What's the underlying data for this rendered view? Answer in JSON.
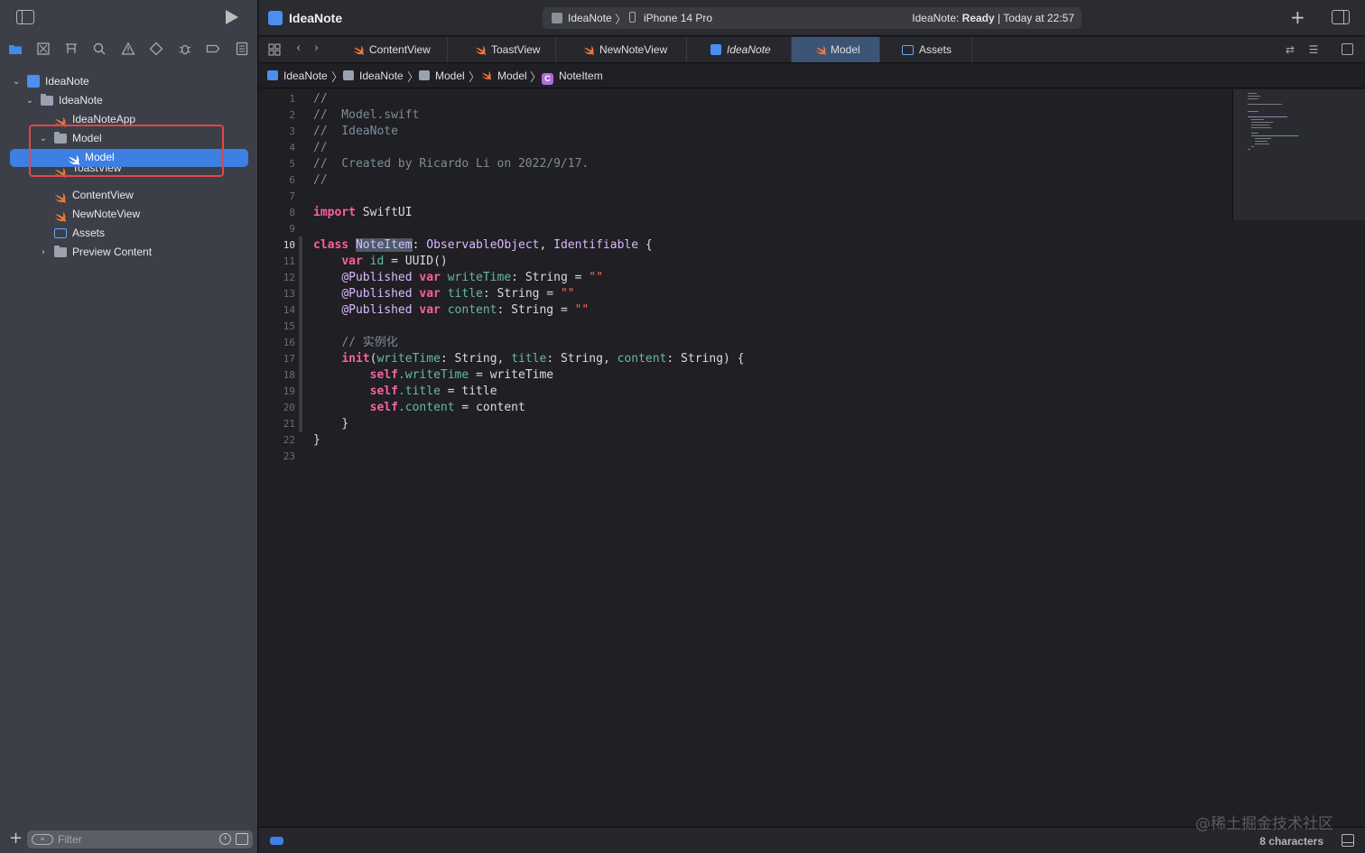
{
  "sidebar": {
    "navigator_icons": [
      "folder-icon",
      "source-control-icon",
      "symbol-icon",
      "search-icon",
      "warning-icon",
      "test-icon",
      "debug-icon",
      "breakpoint-icon",
      "report-icon"
    ],
    "tree": {
      "project": "IdeaNote",
      "group": "IdeaNote",
      "app_file": "IdeaNoteApp",
      "model_folder": "Model",
      "model_file": "Model",
      "toast_file": "ToastView",
      "content_file": "ContentView",
      "newnote_file": "NewNoteView",
      "assets": "Assets",
      "preview_folder": "Preview Content"
    },
    "filter_placeholder": "Filter"
  },
  "toolbar": {
    "title": "IdeaNote",
    "scheme": "IdeaNote",
    "device": "iPhone 14 Pro",
    "status_prefix": "IdeaNote: ",
    "status_state": "Ready",
    "status_suffix": " | Today at 22:57"
  },
  "tabs": [
    {
      "label": "ContentView"
    },
    {
      "label": "ToastView"
    },
    {
      "label": "NewNoteView"
    },
    {
      "label": "IdeaNote"
    },
    {
      "label": "Model"
    },
    {
      "label": "Assets"
    }
  ],
  "breadcrumb": [
    "IdeaNote",
    "IdeaNote",
    "Model",
    "Model",
    "NoteItem"
  ],
  "editor": {
    "current_line": 10,
    "line_numbers": [
      "1",
      "2",
      "3",
      "4",
      "5",
      "6",
      "7",
      "8",
      "9",
      "10",
      "11",
      "12",
      "13",
      "14",
      "15",
      "16",
      "17",
      "18",
      "19",
      "20",
      "21",
      "22",
      "23"
    ],
    "code": {
      "l1": "//",
      "l2": "//  Model.swift",
      "l3": "//  IdeaNote",
      "l4": "//",
      "l5": "//  Created by Ricardo Li on 2022/9/17.",
      "l6": "//",
      "l8_kw": "import",
      "l8_rest": " SwiftUI",
      "l10_kw": "class",
      "l10_name": "NoteItem",
      "l10_colon": ": ",
      "l10_proto1": "ObservableObject",
      "l10_comma": ", ",
      "l10_proto2": "Identifiable",
      "l10_brace": " {",
      "l11_kw": "var",
      "l11_prop": "id",
      "l11_rest": " = UUID()",
      "l12_attr": "@Published ",
      "l12_kw": "var",
      "l12_prop": "writeTime",
      "l12_type": ": String = ",
      "l12_str": "\"\"",
      "l13_attr": "@Published ",
      "l13_kw": "var",
      "l13_prop": "title",
      "l13_type": ": String = ",
      "l13_str": "\"\"",
      "l14_attr": "@Published ",
      "l14_kw": "var",
      "l14_prop": "content",
      "l14_type": ": String = ",
      "l14_str": "\"\"",
      "l16": "// 实例化",
      "l17_kw": "init",
      "l17_p1": "writeTime",
      "l17_t1": ": String, ",
      "l17_p2": "title",
      "l17_t2": ": String, ",
      "l17_p3": "content",
      "l17_t3": ": String) {",
      "l18_kw": "self",
      "l18_prop": ".writeTime",
      "l18_rest": " = writeTime",
      "l19_kw": "self",
      "l19_prop": ".title",
      "l19_rest": " = title",
      "l20_kw": "self",
      "l20_prop": ".content",
      "l20_rest": " = content",
      "l21": "}",
      "l22": "}"
    }
  },
  "status_bar": {
    "watermark": "@稀土掘金技术社区",
    "char_count": "8 characters"
  },
  "colors": {
    "selection": "#3d7fe3",
    "keyword": "#fc5fa3",
    "comment": "#7f8c98",
    "type": "#dabaff",
    "property": "#67b7a4",
    "string": "#fc6a5d",
    "annotation_box": "#e0464a"
  }
}
